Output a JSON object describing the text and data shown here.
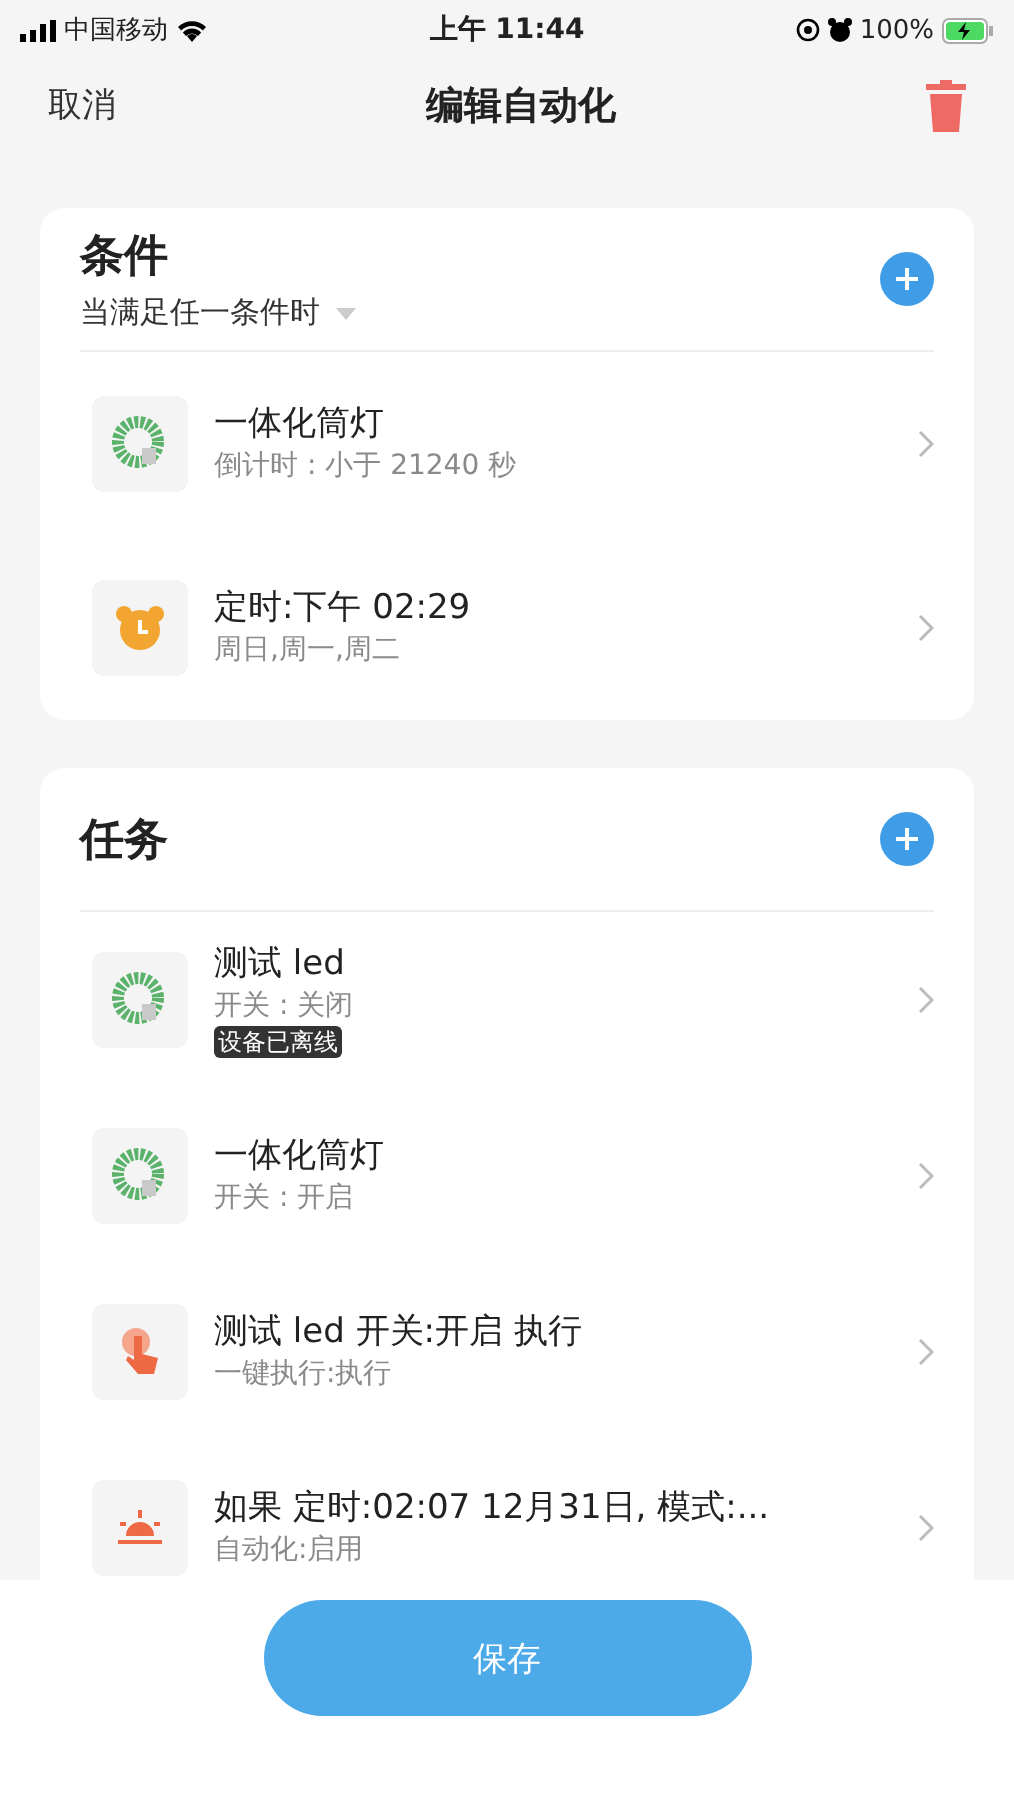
{
  "status_bar": {
    "carrier": "中国移动",
    "time": "上午 11:44",
    "battery": "100%"
  },
  "nav": {
    "cancel": "取消",
    "title": "编辑自动化"
  },
  "conditions": {
    "title": "条件",
    "match_mode": "当满足任一条件时",
    "items": [
      {
        "kind": "device",
        "title": "一体化筒灯",
        "subtitle": "倒计时 : 小于 21240 秒"
      },
      {
        "kind": "alarm",
        "title": "定时:下午 02:29",
        "subtitle": "周日,周一,周二"
      }
    ]
  },
  "tasks": {
    "title": "任务",
    "items": [
      {
        "kind": "device",
        "title": "测试 led",
        "subtitle": "开关 : 关闭",
        "badge": "设备已离线"
      },
      {
        "kind": "device",
        "title": "一体化筒灯",
        "subtitle": "开关 : 开启"
      },
      {
        "kind": "tap",
        "title": "测试 led 开关:开启 执行",
        "subtitle": "一键执行:执行"
      },
      {
        "kind": "sunrise",
        "title": "如果 定时:02:07 12月31日, 模式:...",
        "subtitle": "自动化:启用"
      }
    ]
  },
  "save_button": "保存"
}
